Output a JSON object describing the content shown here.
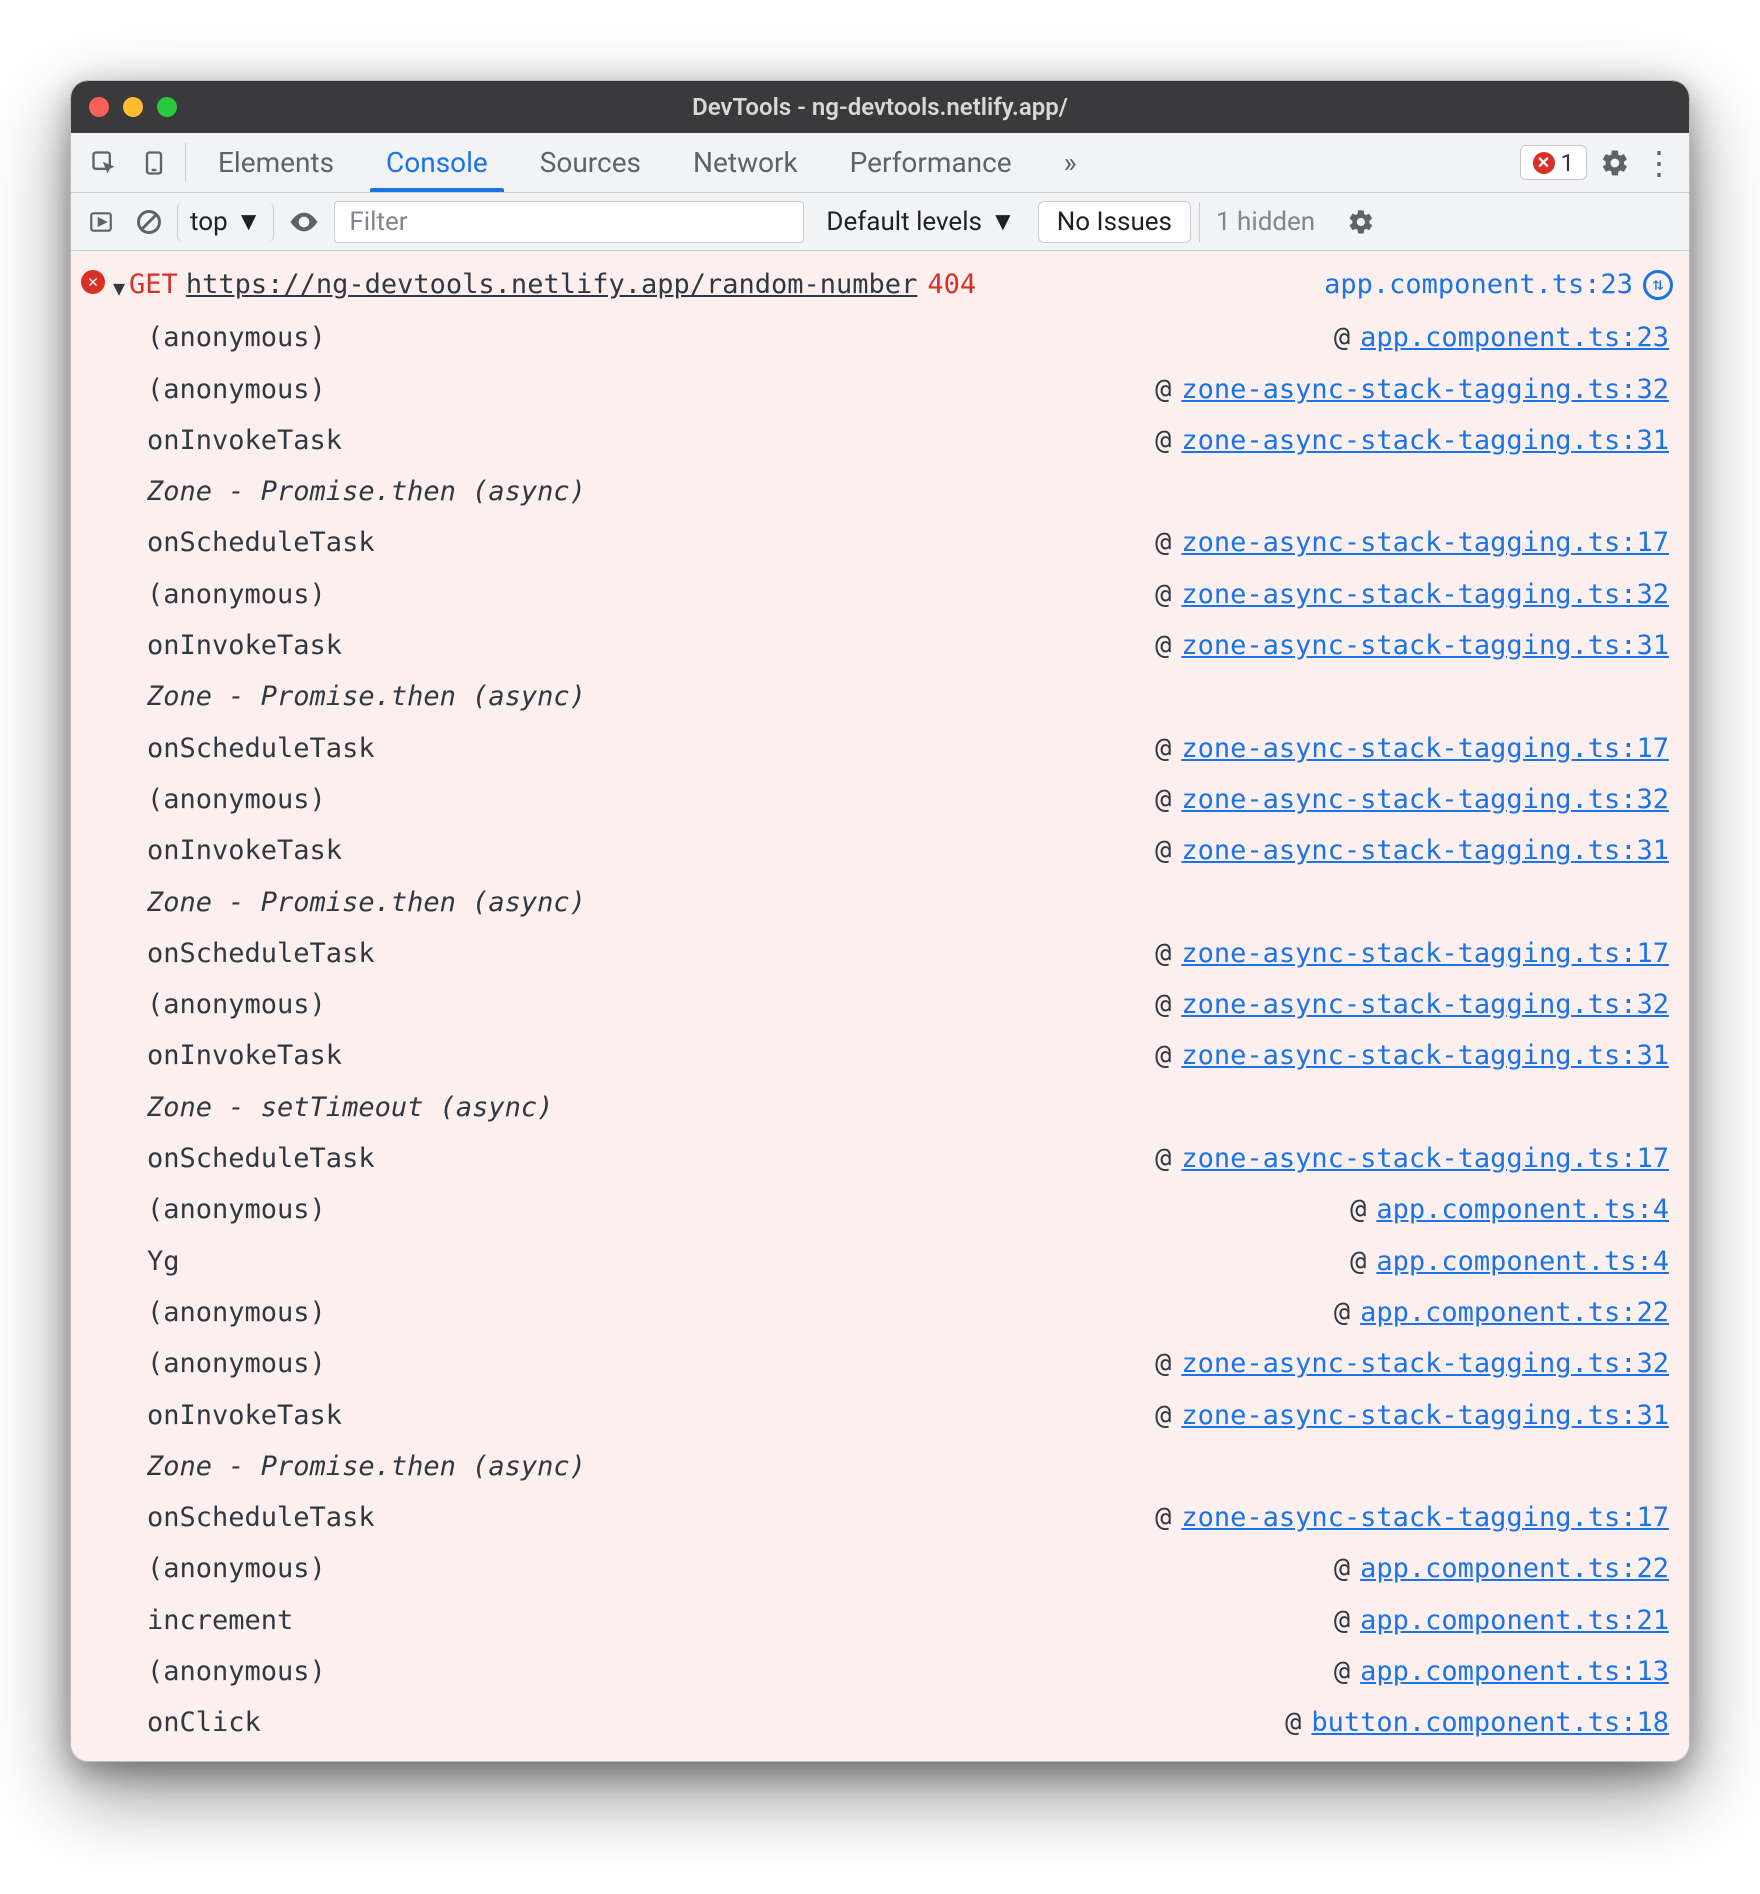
{
  "window": {
    "title": "DevTools - ng-devtools.netlify.app/"
  },
  "tabs": {
    "elements": "Elements",
    "console": "Console",
    "sources": "Sources",
    "network": "Network",
    "performance": "Performance",
    "more": "»"
  },
  "header": {
    "error_count": "1",
    "context": "top",
    "filter_placeholder": "Filter",
    "levels": "Default levels",
    "issues": "No Issues",
    "hidden": "1 hidden"
  },
  "error": {
    "method": "GET",
    "url": "https://ng-devtools.netlify.app/random-number",
    "status": "404",
    "source": "app.component.ts:23"
  },
  "stack": [
    {
      "kind": "frame",
      "fn": "(anonymous)",
      "src": "app.component.ts:23"
    },
    {
      "kind": "frame",
      "fn": "(anonymous)",
      "src": "zone-async-stack-tagging.ts:32"
    },
    {
      "kind": "frame",
      "fn": "onInvokeTask",
      "src": "zone-async-stack-tagging.ts:31"
    },
    {
      "kind": "hdr",
      "fn": "Zone - Promise.then (async)"
    },
    {
      "kind": "frame",
      "fn": "onScheduleTask",
      "src": "zone-async-stack-tagging.ts:17"
    },
    {
      "kind": "frame",
      "fn": "(anonymous)",
      "src": "zone-async-stack-tagging.ts:32"
    },
    {
      "kind": "frame",
      "fn": "onInvokeTask",
      "src": "zone-async-stack-tagging.ts:31"
    },
    {
      "kind": "hdr",
      "fn": "Zone - Promise.then (async)"
    },
    {
      "kind": "frame",
      "fn": "onScheduleTask",
      "src": "zone-async-stack-tagging.ts:17"
    },
    {
      "kind": "frame",
      "fn": "(anonymous)",
      "src": "zone-async-stack-tagging.ts:32"
    },
    {
      "kind": "frame",
      "fn": "onInvokeTask",
      "src": "zone-async-stack-tagging.ts:31"
    },
    {
      "kind": "hdr",
      "fn": "Zone - Promise.then (async)"
    },
    {
      "kind": "frame",
      "fn": "onScheduleTask",
      "src": "zone-async-stack-tagging.ts:17"
    },
    {
      "kind": "frame",
      "fn": "(anonymous)",
      "src": "zone-async-stack-tagging.ts:32"
    },
    {
      "kind": "frame",
      "fn": "onInvokeTask",
      "src": "zone-async-stack-tagging.ts:31"
    },
    {
      "kind": "hdr",
      "fn": "Zone - setTimeout (async)"
    },
    {
      "kind": "frame",
      "fn": "onScheduleTask",
      "src": "zone-async-stack-tagging.ts:17"
    },
    {
      "kind": "frame",
      "fn": "(anonymous)",
      "src": "app.component.ts:4"
    },
    {
      "kind": "frame",
      "fn": "Yg",
      "src": "app.component.ts:4"
    },
    {
      "kind": "frame",
      "fn": "(anonymous)",
      "src": "app.component.ts:22"
    },
    {
      "kind": "frame",
      "fn": "(anonymous)",
      "src": "zone-async-stack-tagging.ts:32"
    },
    {
      "kind": "frame",
      "fn": "onInvokeTask",
      "src": "zone-async-stack-tagging.ts:31"
    },
    {
      "kind": "hdr",
      "fn": "Zone - Promise.then (async)"
    },
    {
      "kind": "frame",
      "fn": "onScheduleTask",
      "src": "zone-async-stack-tagging.ts:17"
    },
    {
      "kind": "frame",
      "fn": "(anonymous)",
      "src": "app.component.ts:22"
    },
    {
      "kind": "frame",
      "fn": "increment",
      "src": "app.component.ts:21"
    },
    {
      "kind": "frame",
      "fn": "(anonymous)",
      "src": "app.component.ts:13"
    },
    {
      "kind": "frame",
      "fn": "onClick",
      "src": "button.component.ts:18"
    }
  ]
}
